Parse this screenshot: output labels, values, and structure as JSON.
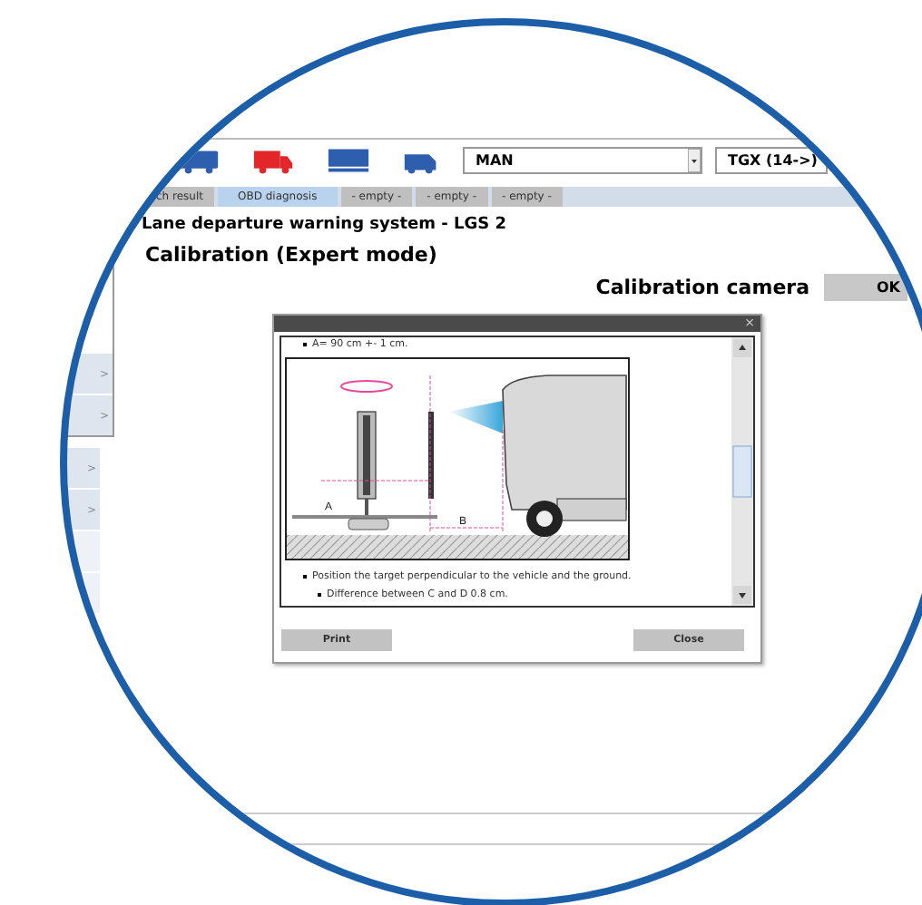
{
  "toolbar": {
    "vehicles": [
      {
        "kind": "bus",
        "selected": false
      },
      {
        "kind": "truck",
        "selected": true
      },
      {
        "kind": "trailer",
        "selected": false
      },
      {
        "kind": "van",
        "selected": false
      }
    ],
    "make": "MAN",
    "model": "TGX (14->)"
  },
  "tabs": [
    {
      "label": "ch result",
      "selected": false
    },
    {
      "label": "OBD diagnosis",
      "selected": true
    },
    {
      "label": "- empty -",
      "selected": false
    },
    {
      "label": "- empty -",
      "selected": false
    },
    {
      "label": "- empty -",
      "selected": false
    }
  ],
  "sidebar": {
    "upper_rows": [
      ">",
      ">"
    ],
    "lower_rows": [
      ">",
      ">"
    ]
  },
  "title": "Lane departure warning system - LGS 2",
  "subtitle": "Calibration (Expert mode)",
  "step": {
    "label": "Calibration camera",
    "button": "OK"
  },
  "dialog": {
    "close": "×",
    "lines": [
      {
        "text": "A= 90 cm +- 1 cm.",
        "level_indent": false
      },
      {
        "text": "Position the target perpendicular to the vehicle and the ground.",
        "level_indent": false
      },
      {
        "text": "Difference between C and D 0.8 cm.",
        "level_indent": true
      }
    ],
    "diagram_labels": [
      "A",
      "B"
    ],
    "buttons": [
      "Print",
      "Close"
    ]
  }
}
